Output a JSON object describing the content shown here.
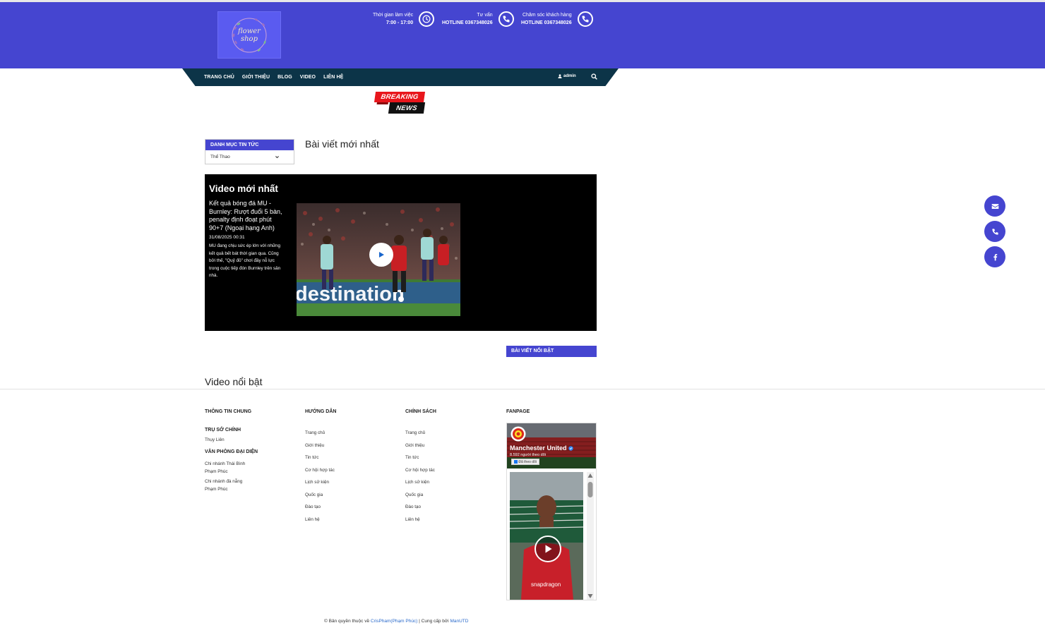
{
  "header": {
    "logo_text_1": "flower",
    "logo_text_2": "shop",
    "working_hours_label": "Thời gian làm việc",
    "working_hours_value": "7:00 - 17:00",
    "consult_label": "Tư vấn",
    "consult_value": "HOTLINE 0367348026",
    "support_label": "Chăm sóc khách hàng",
    "support_value": "HOTLINE 0367348026"
  },
  "nav": {
    "items": [
      "TRANG CHỦ",
      "GIỚI THIỆU",
      "BLOG",
      "VIDEO",
      "LIÊN HỆ"
    ],
    "admin": "admin"
  },
  "breaking": {
    "line1": "BREAKING",
    "line2": "NEWS"
  },
  "category": {
    "heading": "DANH MỤC TIN TỨC",
    "selected": "Thể Thao"
  },
  "latest_posts_title": "Bài viết mới nhất",
  "latest_video": {
    "title": "Video mới nhất",
    "headline": "Kết quả bóng đá MU - Burnley: Rượt đuổi 5 bàn, penalty định đoạt phút 90+7 (Ngoại hạng Anh)",
    "date": "31/08/2025 00:31",
    "description": "MU đang chịu sức ép lớn với những kết quả bết bát thời gian qua. Cũng bởi thế, \"Quỷ đỏ\" chơi đầy nỗ lực trong cuộc tiếp đón Burnley trên sân nhà."
  },
  "featured_posts_label": "BÀI VIẾT NỔI BẬT",
  "featured_videos_title": "Video nổi bật",
  "footer": {
    "col1": {
      "title": "THÔNG TIN CHUNG",
      "hq_title": "TRỤ SỞ CHÍNH",
      "hq_value": "Thụy Liên",
      "rep_title": "VĂN PHÒNG ĐẠI DIỆN",
      "branch1_name": "Chi nhánh Thái Bình",
      "branch1_value": "Phạm Phúc",
      "branch2_name": "Chi nhánh đà nẵng",
      "branch2_value": "Phạm Phúc"
    },
    "col2": {
      "title": "HƯỚNG DẪN",
      "links": [
        "Trang chủ",
        "Giới thiệu",
        "Tin tức",
        "Cơ hội hợp tác",
        "Lịch sử kiện",
        "Quốc gia",
        "Đào tạo",
        "Liên hệ"
      ]
    },
    "col3": {
      "title": "CHÍNH SÁCH",
      "links": [
        "Trang chủ",
        "Giới thiệu",
        "Tin tức",
        "Cơ hội hợp tác",
        "Lịch sử kiện",
        "Quốc gia",
        "Đào tạo",
        "Liên hệ"
      ]
    },
    "col4": {
      "title": "FANPAGE",
      "page_name": "Manchester United",
      "followers": "8.592 người theo dõi",
      "follow_button": "Đã theo dõi"
    }
  },
  "copyright": {
    "prefix": "Bản quyền thuộc về",
    "owner": "CrisPham(Phạm Phúc)",
    "middle": "| Cung cấp bởi",
    "provider": "ManUTD"
  },
  "colors": {
    "brand": "#4545d0",
    "nav": "#0c3448",
    "breaking_red": "#e8161c"
  }
}
